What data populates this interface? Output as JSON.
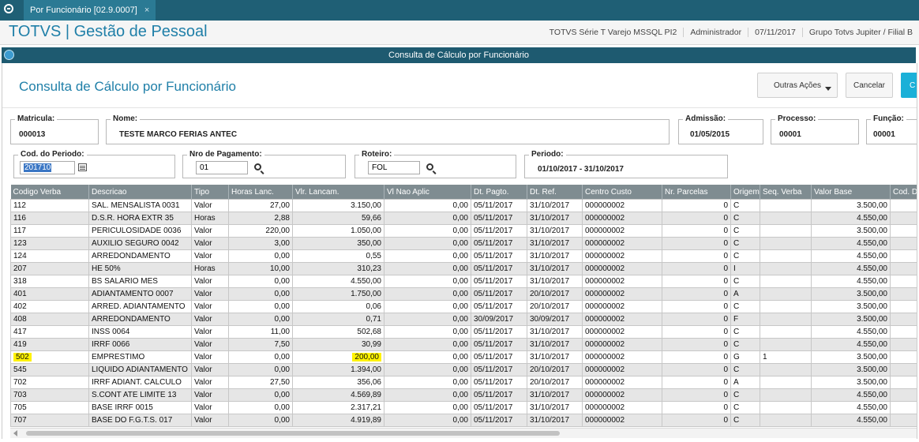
{
  "tab": {
    "label": "Por Funcionário [02.9.0007]",
    "close": "×"
  },
  "app": {
    "title": "TOTVS | Gestão de Pessoal",
    "info": [
      "TOTVS Série T Varejo MSSQL PI2",
      "Administrador",
      "07/11/2017",
      "Grupo Totvs Jupiter / Filial B"
    ]
  },
  "window": {
    "title": "Consulta de Cálculo por Funcionário"
  },
  "page": {
    "title": "Consulta de Cálculo por Funcionário"
  },
  "toolbar": {
    "outras_acoes": "Outras Ações",
    "cancelar": "Cancelar",
    "confirmar": "C"
  },
  "fields": {
    "matricula": {
      "label": "Matricula:",
      "value": "000013"
    },
    "nome": {
      "label": "Nome:",
      "value": "TESTE MARCO FERIAS ANTEC"
    },
    "admissao": {
      "label": "Admissão:",
      "value": "01/05/2015"
    },
    "processo": {
      "label": "Processo:",
      "value": "00001"
    },
    "funcao": {
      "label": "Função:",
      "value": "00001"
    },
    "cod_periodo": {
      "label": "Cod. do Periodo:",
      "value": "201710"
    },
    "nro_pagamento": {
      "label": "Nro de Pagamento:",
      "value": "01"
    },
    "roteiro": {
      "label": "Roteiro:",
      "value": "FOL"
    },
    "periodo": {
      "label": "Periodo:",
      "value": "01/10/2017 - 31/10/2017"
    }
  },
  "table": {
    "columns": [
      "Codigo Verba",
      "Descricao",
      "Tipo",
      "Horas Lanc.",
      "Vlr. Lancam.",
      "Vl Nao Aplic",
      "Dt. Pagto.",
      "Dt. Ref.",
      "Centro Custo",
      "Nr. Parcelas",
      "Origem",
      "Seq. Verba",
      "Valor Base",
      "Cod. Depto."
    ],
    "rows": [
      [
        "112",
        "SAL. MENSALISTA 0031",
        "Valor",
        "27,00",
        "3.150,00",
        "0,00",
        "05/11/2017",
        "31/10/2017",
        "000000002",
        "0",
        "C",
        "",
        "3.500,00",
        ""
      ],
      [
        "116",
        "D.S.R. HORA EXTR  35",
        "Horas",
        "2,88",
        "59,66",
        "0,00",
        "05/11/2017",
        "31/10/2017",
        "000000002",
        "0",
        "C",
        "",
        "4.550,00",
        ""
      ],
      [
        "117",
        "PERICULOSIDADE 0036",
        "Valor",
        "220,00",
        "1.050,00",
        "0,00",
        "05/11/2017",
        "31/10/2017",
        "000000002",
        "0",
        "C",
        "",
        "3.500,00",
        ""
      ],
      [
        "123",
        "AUXILIO SEGURO 0042",
        "Valor",
        "3,00",
        "350,00",
        "0,00",
        "05/11/2017",
        "31/10/2017",
        "000000002",
        "0",
        "C",
        "",
        "4.550,00",
        ""
      ],
      [
        "124",
        "ARREDONDAMENTO",
        "Valor",
        "0,00",
        "0,55",
        "0,00",
        "05/11/2017",
        "31/10/2017",
        "000000002",
        "0",
        "C",
        "",
        "4.550,00",
        ""
      ],
      [
        "207",
        "HE  50%",
        "Horas",
        "10,00",
        "310,23",
        "0,00",
        "05/11/2017",
        "31/10/2017",
        "000000002",
        "0",
        "I",
        "",
        "4.550,00",
        ""
      ],
      [
        "318",
        "BS SALARIO MES",
        "Valor",
        "0,00",
        "4.550,00",
        "0,00",
        "05/11/2017",
        "31/10/2017",
        "000000002",
        "0",
        "C",
        "",
        "4.550,00",
        ""
      ],
      [
        "401",
        "ADIANTAMENTO 0007",
        "Valor",
        "0,00",
        "1.750,00",
        "0,00",
        "05/11/2017",
        "20/10/2017",
        "000000002",
        "0",
        "A",
        "",
        "3.500,00",
        ""
      ],
      [
        "402",
        "ARRED. ADIANTAMENTO",
        "Valor",
        "0,00",
        "0,06",
        "0,00",
        "05/11/2017",
        "20/10/2017",
        "000000002",
        "0",
        "C",
        "",
        "3.500,00",
        ""
      ],
      [
        "408",
        "ARREDONDAMENTO",
        "Valor",
        "0,00",
        "0,71",
        "0,00",
        "30/09/2017",
        "30/09/2017",
        "000000002",
        "0",
        "F",
        "",
        "3.500,00",
        ""
      ],
      [
        "417",
        "INSS 0064",
        "Valor",
        "11,00",
        "502,68",
        "0,00",
        "05/11/2017",
        "31/10/2017",
        "000000002",
        "0",
        "C",
        "",
        "4.550,00",
        ""
      ],
      [
        "419",
        "IRRF 0066",
        "Valor",
        "7,50",
        "30,99",
        "0,00",
        "05/11/2017",
        "31/10/2017",
        "000000002",
        "0",
        "C",
        "",
        "4.550,00",
        ""
      ],
      [
        "502",
        "EMPRESTIMO",
        "Valor",
        "0,00",
        "200,00",
        "0,00",
        "05/11/2017",
        "31/10/2017",
        "000000002",
        "0",
        "G",
        "1",
        "3.500,00",
        ""
      ],
      [
        "545",
        "LIQUIDO ADIANTAMENTO",
        "Valor",
        "0,00",
        "1.394,00",
        "0,00",
        "05/11/2017",
        "20/10/2017",
        "000000002",
        "0",
        "C",
        "",
        "3.500,00",
        ""
      ],
      [
        "702",
        "IRRF ADIANT. CALCULO",
        "Valor",
        "27,50",
        "356,06",
        "0,00",
        "05/11/2017",
        "20/10/2017",
        "000000002",
        "0",
        "A",
        "",
        "3.500,00",
        ""
      ],
      [
        "703",
        "S.CONT ATE LIMITE 13",
        "Valor",
        "0,00",
        "4.569,89",
        "0,00",
        "05/11/2017",
        "31/10/2017",
        "000000002",
        "0",
        "C",
        "",
        "4.550,00",
        ""
      ],
      [
        "705",
        "BASE IRRF 0015",
        "Valor",
        "0,00",
        "2.317,21",
        "0,00",
        "05/11/2017",
        "31/10/2017",
        "000000002",
        "0",
        "C",
        "",
        "4.550,00",
        ""
      ],
      [
        "707",
        "BASE DO F.G.T.S. 017",
        "Valor",
        "0,00",
        "4.919,89",
        "0,00",
        "05/11/2017",
        "31/10/2017",
        "000000002",
        "0",
        "C",
        "",
        "4.550,00",
        ""
      ]
    ],
    "highlight_row": 12,
    "highlight_color": "#fff200"
  },
  "colors": {
    "topbar": "#1f5f75",
    "title_blue": "#1f7fa8",
    "header_gray": "#7f8c91",
    "confirm_button": "#1bb0d8"
  },
  "icons": {
    "calendar": "calendar-icon",
    "search": "search-icon"
  }
}
